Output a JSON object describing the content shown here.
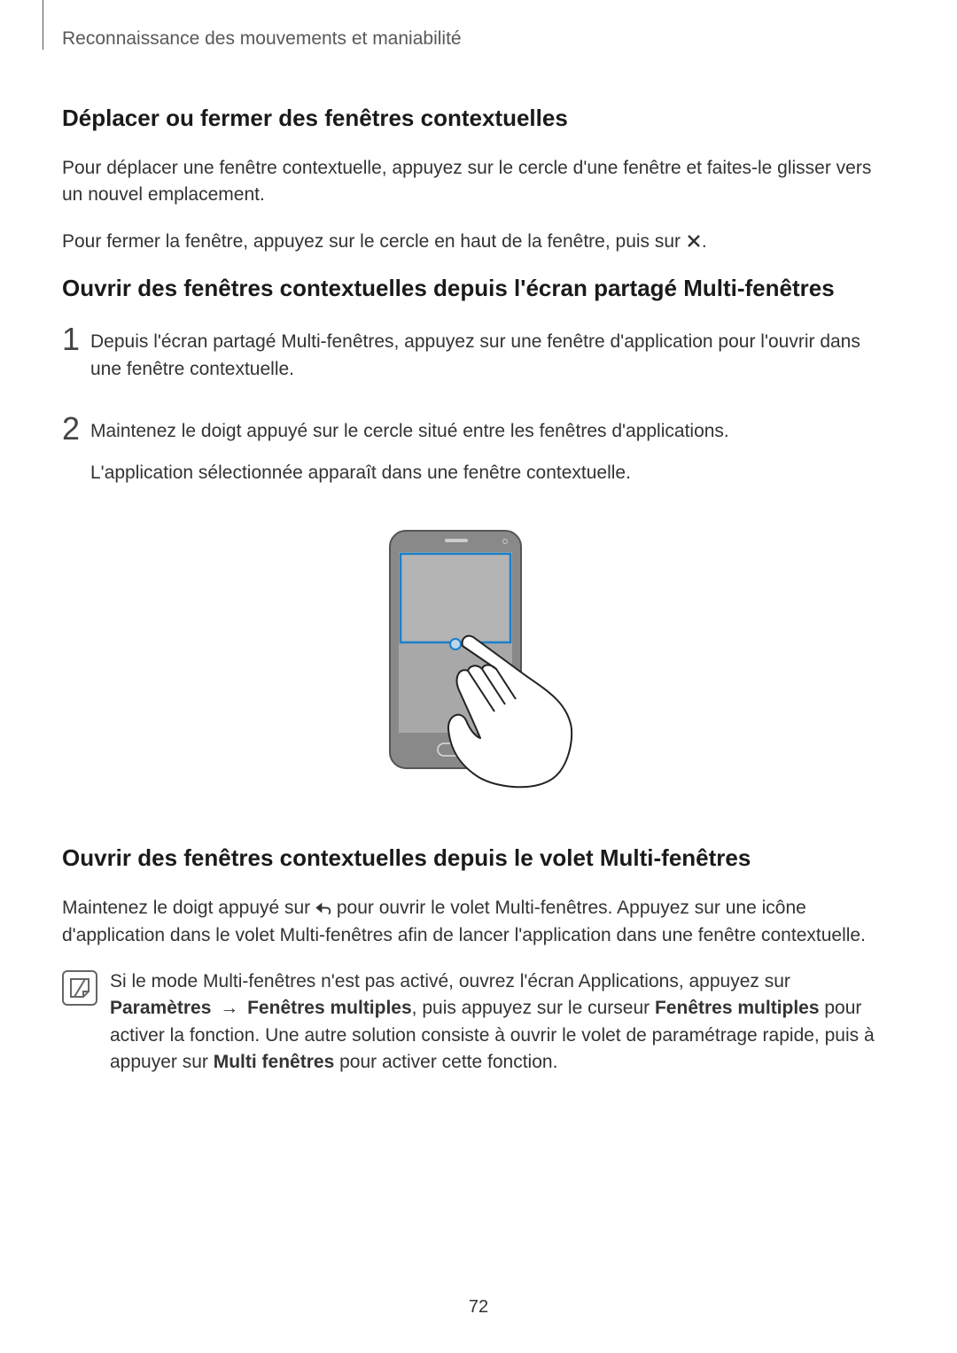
{
  "header": {
    "running_title": "Reconnaissance des mouvements et maniabilité"
  },
  "section1": {
    "heading": "Déplacer ou fermer des fenêtres contextuelles",
    "p1": "Pour déplacer une fenêtre contextuelle, appuyez sur le cercle d'une fenêtre et faites-le glisser vers un nouvel emplacement.",
    "p2a": "Pour fermer la fenêtre, appuyez sur le cercle en haut de la fenêtre, puis sur ",
    "p2b": "."
  },
  "section2": {
    "heading": "Ouvrir des fenêtres contextuelles depuis l'écran partagé Multi-fenêtres",
    "step1_num": "1",
    "step1_text": "Depuis l'écran partagé Multi-fenêtres, appuyez sur une fenêtre d'application pour l'ouvrir dans une fenêtre contextuelle.",
    "step2_num": "2",
    "step2_text1": "Maintenez le doigt appuyé sur le cercle situé entre les fenêtres d'applications.",
    "step2_text2": "L'application sélectionnée apparaît dans une fenêtre contextuelle."
  },
  "section3": {
    "heading": "Ouvrir des fenêtres contextuelles depuis le volet Multi-fenêtres",
    "p1a": "Maintenez le doigt appuyé sur ",
    "p1b": " pour ouvrir le volet Multi-fenêtres. Appuyez sur une icône d'application dans le volet Multi-fenêtres afin de lancer l'application dans une fenêtre contextuelle.",
    "note_a": "Si le mode Multi-fenêtres n'est pas activé, ouvrez l'écran Applications, appuyez sur ",
    "note_b1": "Paramètres",
    "note_arrow": "→",
    "note_b2": "Fenêtres multiples",
    "note_c": ", puis appuyez sur le curseur ",
    "note_d": "Fenêtres multiples",
    "note_e": " pour activer la fonction. Une autre solution consiste à ouvrir le volet de paramétrage rapide, puis à appuyer sur ",
    "note_f": "Multi fenêtres",
    "note_g": " pour activer cette fonction."
  },
  "footer": {
    "page_number": "72"
  }
}
